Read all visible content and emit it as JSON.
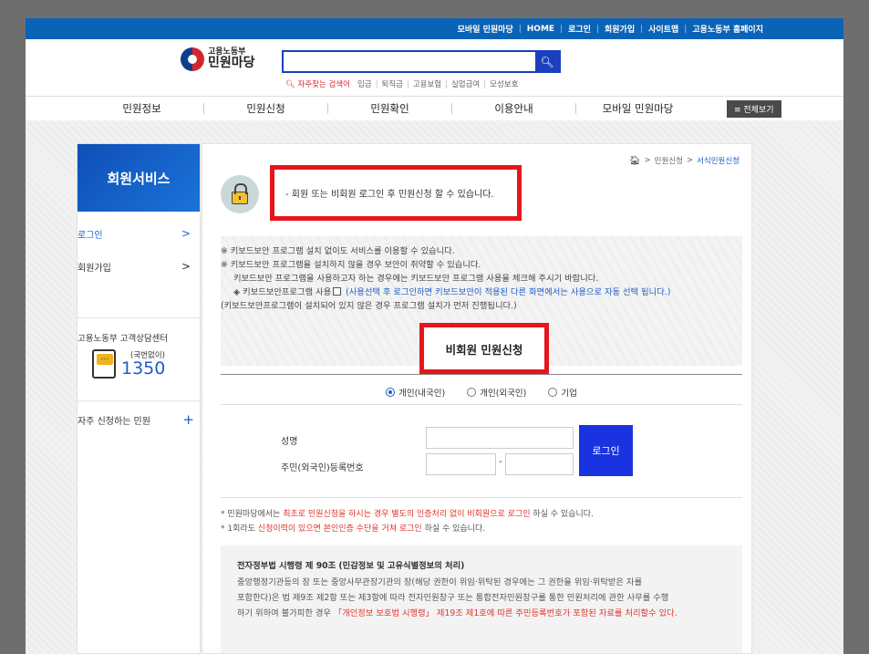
{
  "topbar": {
    "links": [
      "모바일 민원마당",
      "HOME",
      "로그인",
      "회원가입",
      "사이트맵",
      "고용노동부 홈페이지"
    ]
  },
  "logo": {
    "top": "고용노동부",
    "main": "민원마당"
  },
  "search": {
    "placeholder": "",
    "button_icon": "search-icon",
    "popular_label": "자주찾는 검색어",
    "keywords": [
      "임금",
      "퇴직금",
      "고용보험",
      "실업급여",
      "모성보호"
    ]
  },
  "gnb": {
    "items": [
      "민원정보",
      "민원신청",
      "민원확인",
      "이용안내",
      "모바일 민원마당"
    ],
    "all_label": "≡ 전체보기"
  },
  "lnb": {
    "title": "회원서비스",
    "items": [
      {
        "label": "로그인",
        "active": true
      },
      {
        "label": "회원가입",
        "active": false
      }
    ],
    "call_center": {
      "title": "고용노동부 고객상담센터",
      "note": "(국번없이)",
      "number": "1350"
    },
    "faq_label": "자주 신청하는 민원"
  },
  "breadcrumb": {
    "items": [
      "민원신청",
      "서식민원신청"
    ]
  },
  "notice": {
    "text": "- 회원 또는 비회원 로그인 후 민원신청 할 수 있습니다."
  },
  "keyboard": {
    "line1": "※ 키보드보안 프로그램 설치 없이도 서비스를 이용할 수 있습니다.",
    "line2": "※ 키보드보안 프로그램을 설치하지 않을 경우 보안이 취약할 수 있습니다.",
    "line3": "키보드보안 프로그램을 사용하고자 하는 경우에는 키보드보안 프로그램 사용을 체크해 주시기 바랍니다.",
    "option_label": "◈ 키보드보안프로그램  사용",
    "option_note": "(사용선택 후 로그인하면 키보드보안이 적용된 다른 화면에서는 사용으로 자동 선택 됩니다.)",
    "line5": "(키보드보안프로그램이 설치되어 있지 않은 경우 프로그램 설치가 먼저 진행됩니다.)"
  },
  "nonmember_title": "비회원 민원신청",
  "radios": [
    {
      "label": "개인(내국인)",
      "checked": true
    },
    {
      "label": "개인(외국인)",
      "checked": false
    },
    {
      "label": "기업",
      "checked": false
    }
  ],
  "form": {
    "name_label": "성명",
    "id_label": "주민(외국인)등록번호",
    "dash": "-",
    "name_value": "",
    "id_front_value": "",
    "id_back_value": "",
    "login_label": "로그인"
  },
  "info": {
    "line1_a": "* 민원마당에서는 ",
    "line1_b": "최초로 민원신청을 하시는 경우 별도의 인증처리 없이 비회원으로 로그인",
    "line1_c": " 하실 수 있습니다.",
    "line2_a": "* 1회라도 ",
    "line2_b": "신청이력이 있으면 본인인증 수단을 거쳐 로그인",
    "line2_c": " 하실 수 있습니다."
  },
  "law": {
    "title": "전자정부법 시행령 제 90조 (민감정보 및 고유식별정보의 처리)",
    "p1": "중앙행정기관등의 장 또는 중앙사무관장기관의 장(해당 권한이 위임·위탁된 경우에는 그 권한을 위임·위탁받은 자를",
    "p2": "포함한다)은 법 제9조 제2항 또는 제3항에 따라 전자민원창구 또는 통합전자민원창구를 통한 민원처리에 관한 사무를 수행",
    "p3_a": "하기 위하여 불가피한 경우 ",
    "p3_b": "「개인정보 보호법 시행령」 제19조 제1호에 따른 주민등록번호가 포함된 자료를 처리할수 있다."
  },
  "colors": {
    "topbar": "#0b63b7",
    "accent": "#1c5ec5",
    "highlight_box": "#e4161c",
    "login_button": "#1a33e0"
  }
}
